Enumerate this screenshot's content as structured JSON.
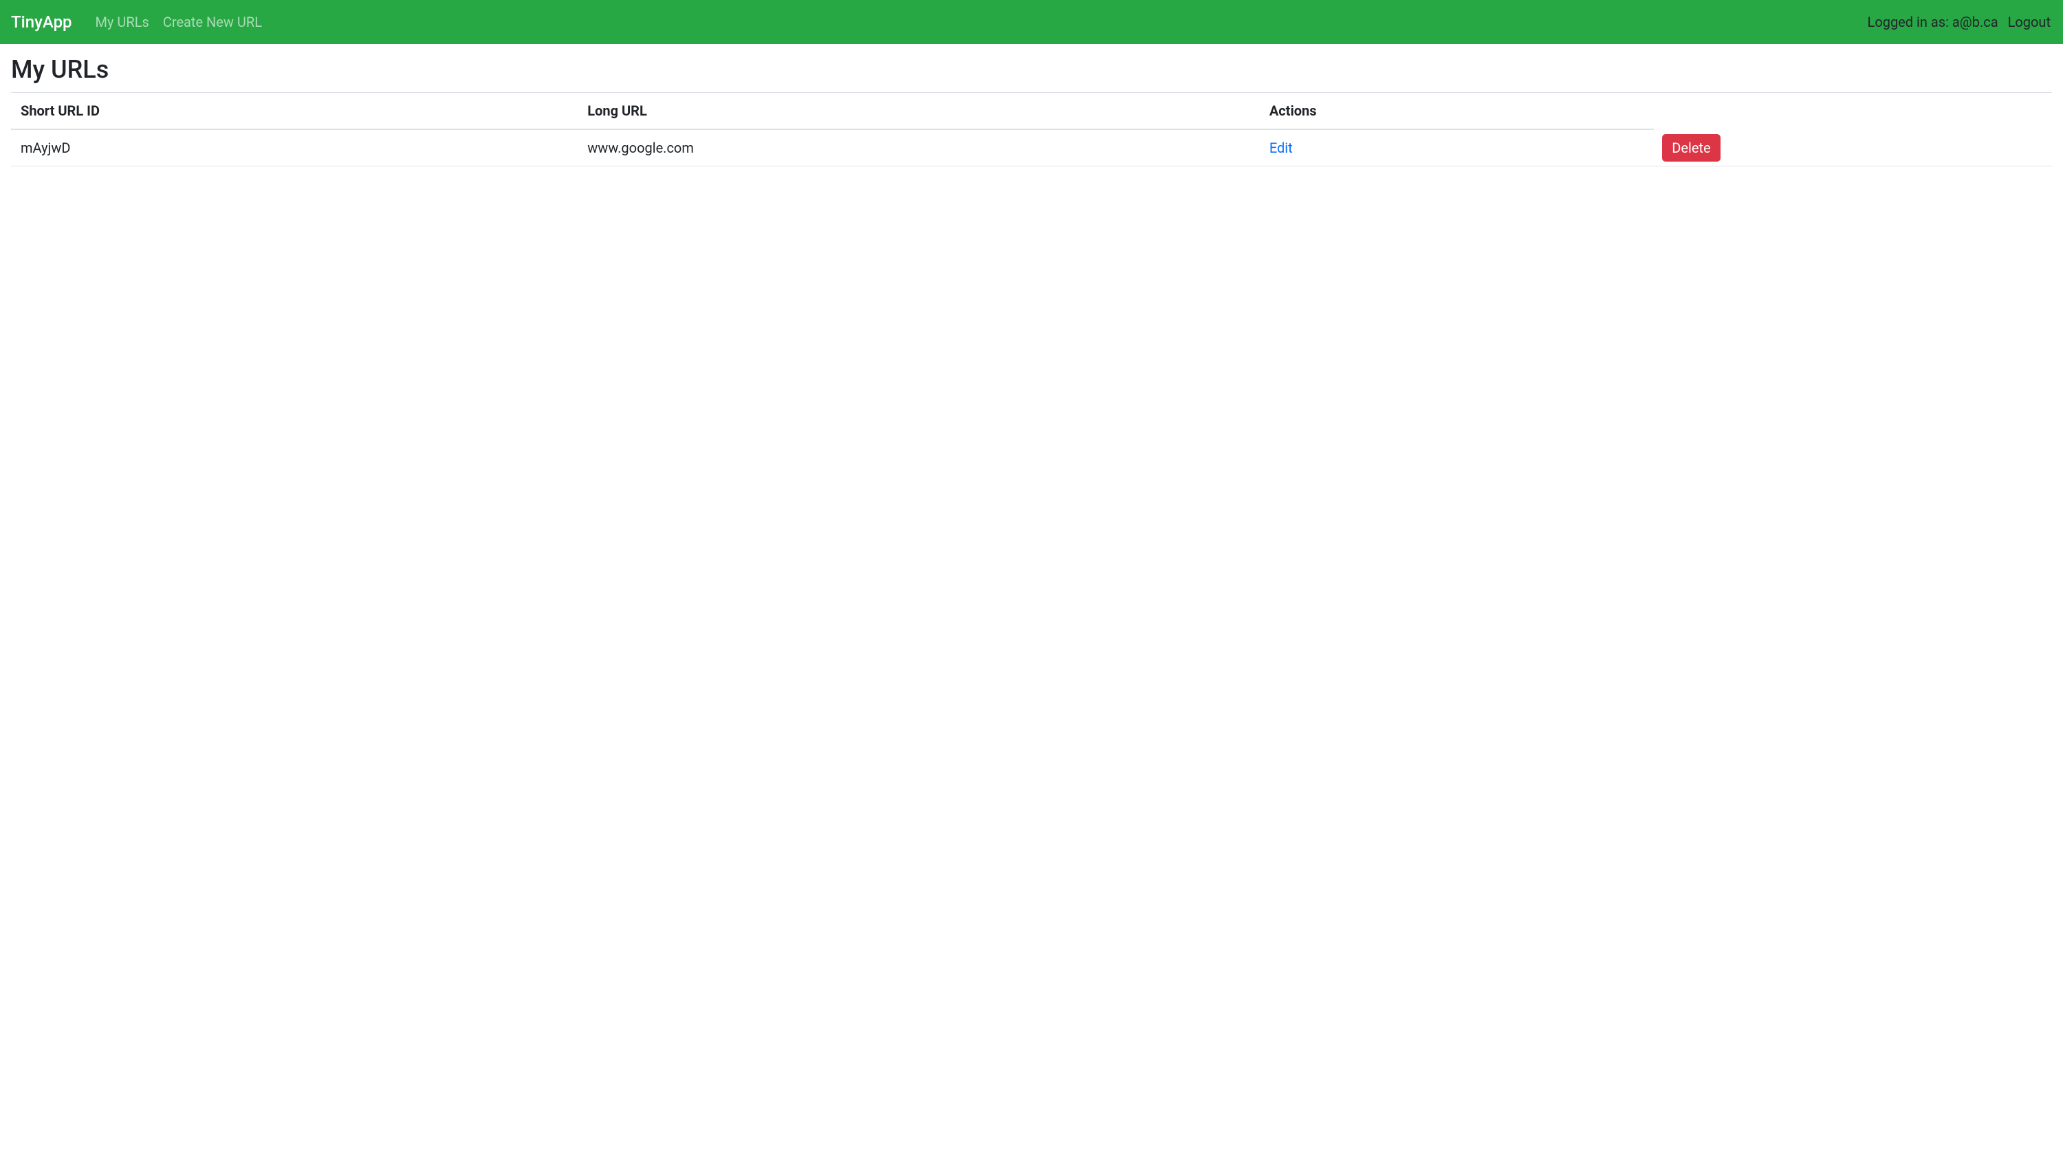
{
  "navbar": {
    "brand": "TinyApp",
    "links": {
      "my_urls": "My URLs",
      "create_new_url": "Create New URL"
    },
    "logged_in_text": "Logged in as: a@b.ca",
    "logout_label": "Logout"
  },
  "page": {
    "title": "My URLs"
  },
  "table": {
    "headers": {
      "short_url_id": "Short URL ID",
      "long_url": "Long URL",
      "actions": "Actions"
    },
    "rows": [
      {
        "short_id": "mAyjwD",
        "long_url": "www.google.com",
        "edit_label": "Edit",
        "delete_label": "Delete"
      }
    ]
  }
}
